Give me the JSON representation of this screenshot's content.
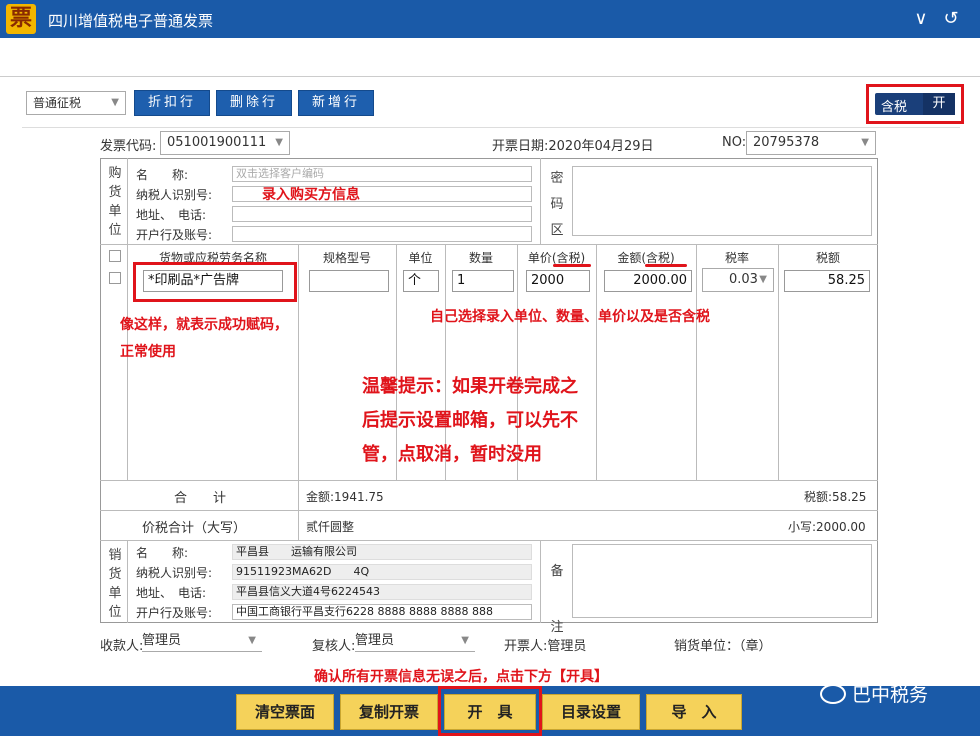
{
  "window": {
    "logo_char": "票",
    "title": "四川增值税电子普通发票",
    "min_icon": "∨",
    "back_icon": "↺"
  },
  "toolbar": {
    "tax_type": "普通征税",
    "btn_discount": "折扣行",
    "btn_delete": "删除行",
    "btn_add": "新增行",
    "toggle_label": "含税",
    "toggle_state": "开"
  },
  "header": {
    "code_label": "发票代码:",
    "code_value": "051001900111",
    "date_label": "开票日期:2020年04月29日",
    "no_label": "NO:",
    "no_value": "20795378"
  },
  "buyer": {
    "side_label": [
      "购",
      "货",
      "单",
      "位"
    ],
    "name_label": "名　　称:",
    "name_placeholder": "双击选择客户编码",
    "taxid_label": "纳税人识别号:",
    "addr_label": "地址、　电话:",
    "bank_label": "开户行及账号:",
    "secret_label": [
      "密",
      "码",
      "区"
    ]
  },
  "items": {
    "headers": [
      "货物或应税劳务名称",
      "规格型号",
      "单位",
      "数量",
      "单价(含税)",
      "金额(含税)",
      "税率",
      "税额"
    ],
    "row": {
      "name": "*印刷品*广告牌",
      "spec": "",
      "unit": "个",
      "qty": "1",
      "price": "2000",
      "amount": "2000.00",
      "rate": "0.03",
      "tax": "58.25"
    }
  },
  "totals": {
    "sum_label": "合　　计",
    "amount_label": "金额:1941.75",
    "tax_label": "税额:58.25",
    "total_label": "价税合计（大写）",
    "total_upper": "贰仟圆整",
    "total_lower": "小写:2000.00"
  },
  "seller": {
    "side_label": [
      "销",
      "货",
      "单",
      "位"
    ],
    "name_label": "名　　称:",
    "name_value": "平昌县　　运输有限公司",
    "taxid_label": "纳税人识别号:",
    "taxid_value": "91511923MA62D　　4Q",
    "addr_label": "地址、　电话:",
    "addr_value": "平昌县信义大道4号6224543",
    "bank_label": "开户行及账号:",
    "bank_value": "中国工商银行平昌支行6228 8888 8888 8888 888",
    "note_label": [
      "备",
      "注"
    ]
  },
  "footer": {
    "payee_label": "收款人:",
    "payee_value": "管理员",
    "reviewer_label": "复核人:",
    "reviewer_value": "管理员",
    "issuer_label": "开票人:管理员",
    "seal_label": "销货单位：（章）"
  },
  "annotations": {
    "buyer_info": "录入购买方信息",
    "success_1": "像这样，就表示成功赋码，",
    "success_2": "正常使用",
    "choose": "自己选择录入单位、数量、单价以及是否含税",
    "tip_1": "温馨提示：如果开卷完成之",
    "tip_2": "后提示设置邮箱，可以先不",
    "tip_3": "管，点取消，暂时没用",
    "confirm": "确认所有开票信息无误之后，点击下方【开具】"
  },
  "bottom": {
    "btn_clear": "清空票面",
    "btn_copy": "复制开票",
    "btn_issue": "开　具",
    "btn_catalog": "目录设置",
    "btn_import": "导　入",
    "wechat_label": "巴中税务"
  }
}
